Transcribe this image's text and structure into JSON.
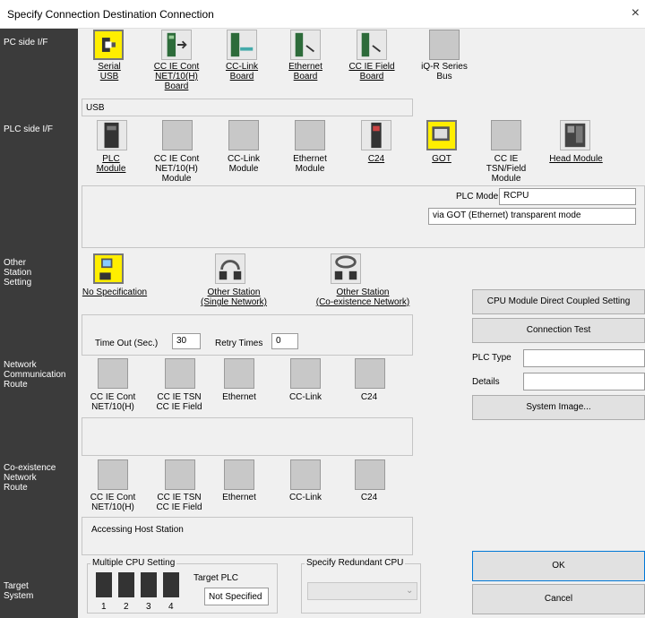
{
  "window": {
    "title": "Specify Connection Destination Connection",
    "close": "×"
  },
  "sidebar": {
    "pc_side": "PC side I/F",
    "plc_side": "PLC side I/F",
    "other_station": "Other\nStation\nSetting",
    "network_route": "Network\nCommunication\nRoute",
    "coexistence_route": "Co-existence\nNetwork\nRoute",
    "target_system": "Target\nSystem"
  },
  "pc_side": {
    "items": [
      {
        "label": "Serial\nUSB",
        "icon": "serial-usb-icon"
      },
      {
        "label": "CC IE Cont\nNET/10(H)\nBoard",
        "icon": "cc-ie-cont-board-icon"
      },
      {
        "label": "CC-Link\nBoard",
        "icon": "cc-link-board-icon"
      },
      {
        "label": "Ethernet\nBoard",
        "icon": "ethernet-board-icon"
      },
      {
        "label": "CC IE Field\nBoard",
        "icon": "cc-ie-field-board-icon"
      },
      {
        "label": "iQ-R Series\nBus",
        "icon": "iq-r-bus-icon"
      }
    ],
    "detail": "USB"
  },
  "plc_side": {
    "items": [
      {
        "label": "PLC\nModule"
      },
      {
        "label": "CC IE Cont\nNET/10(H)\nModule"
      },
      {
        "label": "CC-Link\nModule"
      },
      {
        "label": "Ethernet\nModule"
      },
      {
        "label": "C24"
      },
      {
        "label": "GOT"
      },
      {
        "label": "CC IE\nTSN/Field\nModule"
      },
      {
        "label": "Head Module"
      }
    ],
    "plc_mode_label": "PLC Mode",
    "plc_mode_value": "RCPU",
    "via_text": "via GOT (Ethernet) transparent mode"
  },
  "other_station": {
    "items": [
      {
        "label": "No Specification"
      },
      {
        "label": "Other Station\n(Single Network)"
      },
      {
        "label": "Other Station\n(Co-existence Network)"
      }
    ],
    "timeout_label": "Time Out (Sec.)",
    "timeout_value": "30",
    "retry_label": "Retry Times",
    "retry_value": "0"
  },
  "network_route": {
    "items": [
      "CC IE Cont\nNET/10(H)",
      "CC IE TSN\nCC IE Field",
      "Ethernet",
      "CC-Link",
      "C24"
    ]
  },
  "coexistence_route": {
    "items": [
      "CC IE Cont\nNET/10(H)",
      "CC IE TSN\nCC IE Field",
      "Ethernet",
      "CC-Link",
      "C24"
    ],
    "accessing": "Accessing Host Station"
  },
  "target": {
    "multiple_cpu_label": "Multiple CPU Setting",
    "cpus": [
      "1",
      "2",
      "3",
      "4"
    ],
    "target_plc_label": "Target PLC",
    "target_plc_value": "Not Specified",
    "redundant_label": "Specify Redundant CPU",
    "redundant_value": ""
  },
  "buttons": {
    "cpu_direct": "CPU Module Direct Coupled Setting",
    "connection_test": "Connection Test",
    "system_image": "System Image...",
    "ok": "OK",
    "cancel": "Cancel"
  },
  "right": {
    "plc_type_label": "PLC Type",
    "plc_type_value": "",
    "details_label": "Details",
    "details_value": ""
  },
  "colors": {
    "sidebar": "#3b3b3b",
    "selected": "#ffee00",
    "icon_gray": "#c8c8c8"
  }
}
